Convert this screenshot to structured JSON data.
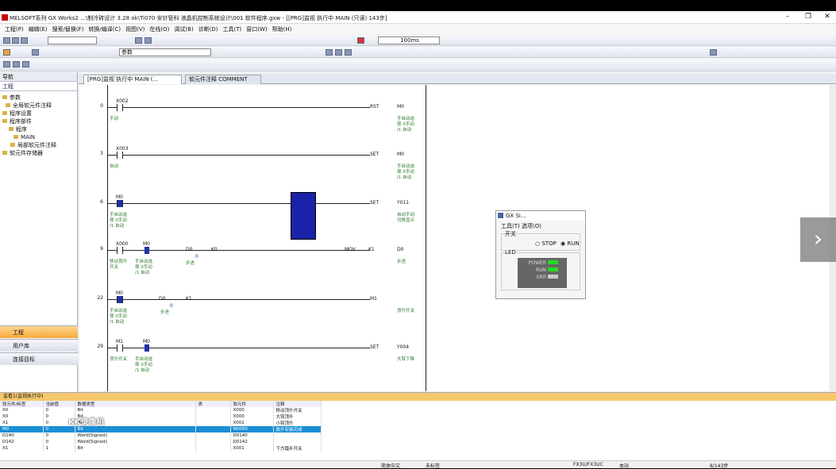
{
  "title": "MELSOFT系列 GX Works2 ...\\制冷砖设计 3.28 ok\\Ti070 安针管科 液晶机控制系统设计\\001 软件程序.gxw - [[PRG]监视 执行中 MAIN (只读) 143步]",
  "menu": [
    "工程(P)",
    "编辑(E)",
    "搜索/替换(F)",
    "转换/编译(C)",
    "视图(V)",
    "在线(O)",
    "调试(B)",
    "诊断(D)",
    "工具(T)",
    "窗口(W)",
    "帮助(H)"
  ],
  "toolbar": {
    "scan_value": "100ms",
    "combo_label": "参数"
  },
  "dock": {
    "title": "导航",
    "section": "工程",
    "tree": [
      "参数",
      "全局软元件注释",
      "程序设置",
      "程序部件",
      "程序",
      "MAIN",
      "局部软元件注释",
      "软元件存储器"
    ],
    "nav": [
      "工程",
      "用户库",
      "连接目标"
    ]
  },
  "tabs": [
    "[PRG]监视 执行中 MAIN (...",
    "软元件注释 COMMENT"
  ],
  "ladder": {
    "rows": [
      {
        "step": "0",
        "contact": "X002",
        "contact_comment": "手动",
        "coil_label": "RST",
        "coil": "M0",
        "coil_comment": "手自动选\n择 0手动\n/1 自动"
      },
      {
        "step": "3",
        "contact": "X003",
        "contact_comment": "自动",
        "coil_label": "SET",
        "coil": "M0",
        "coil_comment": "手自动选\n择 0手动\n/1 自动"
      },
      {
        "step": "6",
        "contact": "M0",
        "contact_comment": "手自动选\n择 0手动\n/1 自动",
        "coil_label": "SET",
        "coil": "Y011",
        "coil_comment": "自动手动\n切换显示"
      },
      {
        "step": "9",
        "contact": "X000",
        "contact2": "M0",
        "contact_comment": "移动顶升\n开关",
        "contact2_comment": "手自动选\n择 0手动\n/1 自动",
        "d1": "D0",
        "d1v": "0",
        "d1c": "步进",
        "k": "K0",
        "func": "MOV",
        "arg1": "K1",
        "arg2": "D0",
        "arg2c": "步进"
      },
      {
        "step": "22",
        "contact": "M0",
        "contact_comment": "手自动选\n择 0手动\n/1 自动",
        "d1": "D0",
        "d1v": "0",
        "d1c": "步进",
        "k": "K1",
        "coil_label": "M1",
        "coil_comment": "顶升开关"
      },
      {
        "step": "29",
        "contact": "M1",
        "contact2": "M0",
        "contact_comment": "顶升开关",
        "contact2_comment": "手自动选\n择 0手动\n/1 自动",
        "coil_label": "SET",
        "coil": "Y004",
        "coil_comment": "大臂下降"
      }
    ]
  },
  "simulator": {
    "title": "GX Si...",
    "menu": "工具(T)  选项(O)",
    "switch": "开关",
    "stop": "STOP",
    "run": "RUN",
    "led": "LED",
    "power": "POWER",
    "run_led": "RUN",
    "err": "ERR"
  },
  "monitor": {
    "title": "监看1(监视执行中)",
    "headers": [
      "软元件/标签",
      "当前值",
      "数据类型",
      "类",
      "软元件",
      "注释"
    ],
    "rows": [
      [
        "X0",
        "0",
        "Bit",
        "",
        "X000",
        "移动顶升开关"
      ],
      [
        "X0",
        "0",
        "Bit",
        "",
        "X000",
        "大臂顶升"
      ],
      [
        "X1",
        "0",
        "Bit",
        "",
        "X001",
        "小臂顶升"
      ],
      [
        "M0",
        "0",
        "Bit",
        "",
        "M0085",
        "脱开安装完成"
      ],
      [
        "D140",
        "0",
        "Word[Signed]",
        "",
        "D0140",
        ""
      ],
      [
        "D142",
        "0",
        "Word[Signed]",
        "",
        "D0142",
        ""
      ],
      [
        "X1",
        "1",
        "Bit",
        "",
        "X001",
        "下方踏步开关"
      ]
    ],
    "watermark": "KK录像机"
  },
  "status": {
    "lang": "简体中文",
    "label": "未标签",
    "plc": "FX3U/FX3UC",
    "mode": "本站",
    "steps": "8/143步"
  }
}
